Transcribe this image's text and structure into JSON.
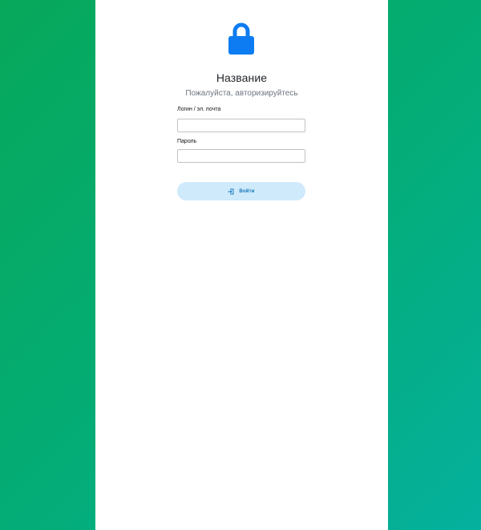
{
  "page": {
    "title": "Название",
    "subtitle": "Пожалуйста, авторизируйтесь"
  },
  "form": {
    "login_label": "Логин / эл. почта",
    "login_value": "",
    "password_label": "Пароль",
    "password_value": "",
    "submit_label": "Войти"
  },
  "icons": {
    "header": "lock-icon",
    "submit": "sign-in-icon"
  },
  "colors": {
    "background_start": "#07a85a",
    "background_end": "#05b09e",
    "lock": "#0d7cf2",
    "button_bg": "#cfeafb",
    "button_text": "#1777b7"
  }
}
